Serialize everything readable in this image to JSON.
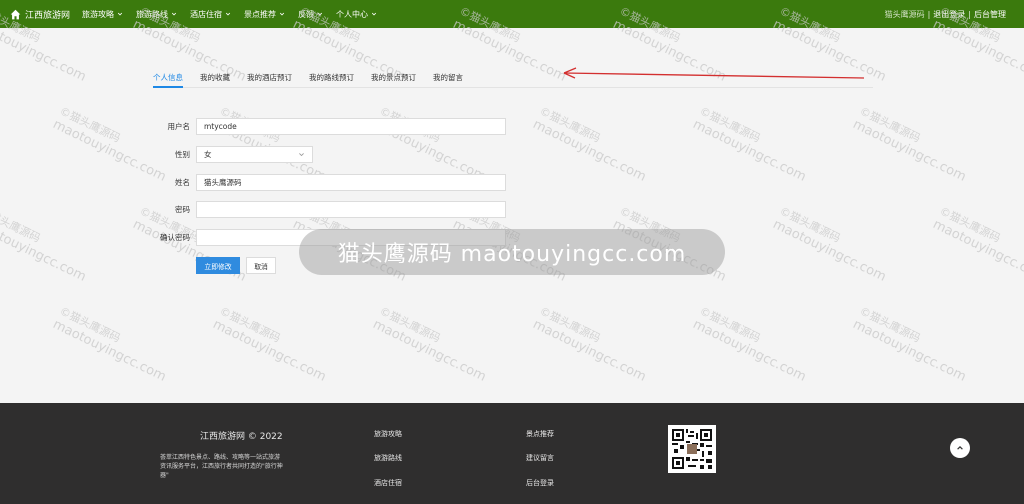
{
  "nav": {
    "brand": "江西旅游网",
    "items": [
      {
        "label": "旅游攻略",
        "id": "travel-guide"
      },
      {
        "label": "旅游路线",
        "id": "travel-routes"
      },
      {
        "label": "酒店住宿",
        "id": "hotel"
      },
      {
        "label": "景点推荐",
        "id": "attractions"
      },
      {
        "label": "反馈",
        "id": "feedback"
      },
      {
        "label": "个人中心",
        "id": "personal-center"
      }
    ],
    "user": "猫头鹰源码",
    "logout": "退出登录",
    "admin": "后台管理"
  },
  "tabs": [
    {
      "label": "个人信息",
      "active": true
    },
    {
      "label": "我的收藏",
      "active": false
    },
    {
      "label": "我的酒店预订",
      "active": false
    },
    {
      "label": "我的路线预订",
      "active": false
    },
    {
      "label": "我的景点预订",
      "active": false
    },
    {
      "label": "我的留言",
      "active": false
    }
  ],
  "form": {
    "username": {
      "label": "用户名",
      "value": "mtycode"
    },
    "gender": {
      "label": "性别",
      "value": "女"
    },
    "name": {
      "label": "姓名",
      "value": "猫头鹰源码"
    },
    "password": {
      "label": "密码",
      "value": ""
    },
    "confirm_password": {
      "label": "确认密码",
      "value": ""
    },
    "submit": "立即修改",
    "cancel": "取消"
  },
  "watermark": {
    "line1": "©猫头鹰源码",
    "line2": "maotouyingcc.com",
    "banner": "猫头鹰源码 maotouyingcc.com"
  },
  "footer": {
    "title": "江西旅游网 © 2022",
    "desc": "荟萃江西特色景点、路线、攻略等一站式旅游资讯服务平台，江西旅行者共同打造的\"旅行神器\"",
    "links_col1": [
      "旅游攻略",
      "旅游路线",
      "酒店住宿"
    ],
    "links_col2": [
      "景点推荐",
      "建议留言",
      "后台登录"
    ]
  },
  "colors": {
    "nav": "#3b7a0d",
    "accent": "#1e88e5",
    "footer": "#2f2e2e"
  }
}
